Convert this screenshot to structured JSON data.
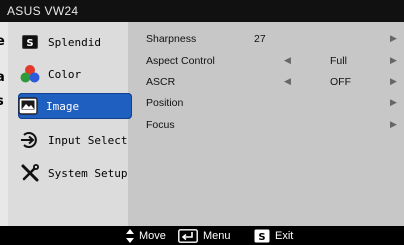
{
  "title": "ASUS VW24",
  "sidebar": {
    "items": [
      {
        "label": "Splendid",
        "icon": "splendid-s-icon"
      },
      {
        "label": "Color",
        "icon": "color-dots-icon"
      },
      {
        "label": "Image",
        "icon": "image-icon",
        "active": true
      },
      {
        "label": "Input Select",
        "icon": "input-arrow-icon"
      },
      {
        "label": "System Setup",
        "icon": "wrench-screwdriver-icon"
      }
    ]
  },
  "settings": [
    {
      "label": "Sharpness",
      "value": "27"
    },
    {
      "label": "Aspect Control",
      "option": "Full"
    },
    {
      "label": "ASCR",
      "option": "OFF"
    },
    {
      "label": "Position"
    },
    {
      "label": "Focus"
    }
  ],
  "footer": {
    "move": "Move",
    "menu": "Menu",
    "exit": "Exit",
    "exit_key": "S"
  },
  "colors": {
    "accent": "#1f5fbf",
    "panel": "#c7c7c7",
    "sidebar": "#dcdcdc"
  }
}
